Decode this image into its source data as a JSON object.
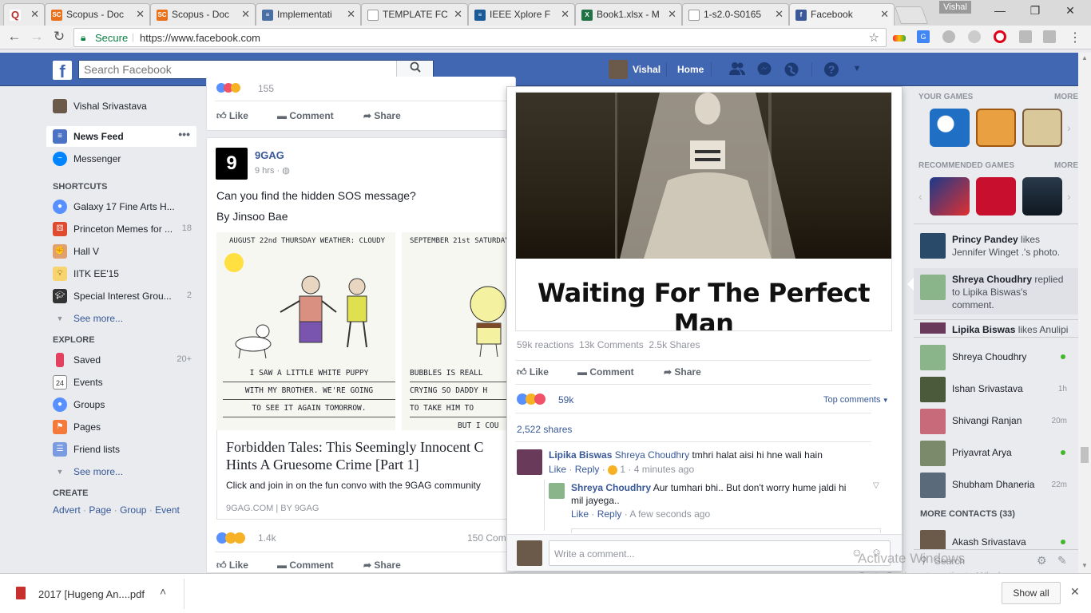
{
  "browser": {
    "tabs": [
      {
        "label": "",
        "icon": "quora-icon",
        "color": "#b92b27",
        "glyph": "Q"
      },
      {
        "label": "Scopus - Doc",
        "icon": "scopus-icon",
        "color": "#e9711c",
        "glyph": "SC"
      },
      {
        "label": "Scopus - Doc",
        "icon": "scopus-icon",
        "color": "#e9711c",
        "glyph": "SC"
      },
      {
        "label": "Implementati",
        "icon": "doc-icon",
        "color": "#4a6fa5",
        "glyph": "≡"
      },
      {
        "label": "TEMPLATE FC",
        "icon": "page-icon",
        "color": "#9e9e9e",
        "glyph": ""
      },
      {
        "label": "IEEE Xplore F",
        "icon": "ieee-icon",
        "color": "#1a5a96",
        "glyph": "≡"
      },
      {
        "label": "Book1.xlsx - M",
        "icon": "excel-icon",
        "color": "#217346",
        "glyph": "X"
      },
      {
        "label": "1-s2.0-S0165",
        "icon": "page-icon",
        "color": "#9e9e9e",
        "glyph": ""
      },
      {
        "label": "Facebook",
        "icon": "facebook-icon",
        "color": "#3b5998",
        "glyph": "f"
      }
    ],
    "profile_label": "Vishal",
    "secure_label": "Secure",
    "url": "https://www.facebook.com"
  },
  "fb": {
    "logo": "f",
    "search_placeholder": "Search Facebook",
    "user_name": "Vishal",
    "home_label": "Home"
  },
  "left_nav": {
    "profile_name": "Vishal Srivastava",
    "news_feed": "News Feed",
    "messenger": "Messenger",
    "shortcuts_head": "SHORTCUTS",
    "shortcuts": [
      {
        "label": "Galaxy 17 Fine Arts H...",
        "count": ""
      },
      {
        "label": "Princeton Memes for ...",
        "count": "18"
      },
      {
        "label": "Hall V",
        "count": ""
      },
      {
        "label": "IITK EE'15",
        "count": ""
      },
      {
        "label": "Special Interest Grou...",
        "count": "2"
      }
    ],
    "see_more": "See more...",
    "explore_head": "EXPLORE",
    "explore": [
      {
        "label": "Saved",
        "count": "20+"
      },
      {
        "label": "Events",
        "count": ""
      },
      {
        "label": "Groups",
        "count": ""
      },
      {
        "label": "Pages",
        "count": ""
      },
      {
        "label": "Friend lists",
        "count": ""
      }
    ],
    "see_more2": "See more...",
    "create_head": "CREATE",
    "create_links": [
      "Advert",
      "Page",
      "Group",
      "Event"
    ]
  },
  "feed": {
    "top_count": "155",
    "like": "Like",
    "comment": "Comment",
    "share": "Share",
    "post": {
      "author": "9GAG",
      "time": "9 hrs",
      "text1": "Can you find the hidden SOS message?",
      "text2": "By Jinsoo Bae",
      "comic_left_header": "AUGUST 22nd THURSDAY   WEATHER: CLOUDY",
      "comic_right_header": "SEPTEMBER 21st SATURDAY",
      "comic_left_caption": [
        "I SAW A LITTLE WHITE PUPPY",
        "WITH MY BROTHER. WE'RE GOING",
        "TO SEE IT AGAIN TOMORROW."
      ],
      "comic_right_caption": [
        "BUBBLES IS REALL",
        "CRYING SO DADDY H",
        "TO TAKE HIM TO",
        "BUT I COU"
      ],
      "link_title": "Forbidden Tales: This Seemingly Innocent C Hints A Gruesome Crime [Part 1]",
      "link_desc": "Click and join in on the fun convo with the 9GAG community",
      "link_domain": "9GAG.COM",
      "link_by": "BY 9GAG",
      "reactions": "1.4k",
      "comments": "150 Com"
    }
  },
  "popup": {
    "image_caption": "Waiting For The Perfect Man",
    "stats": "59k reactions  13k Comments  2.5k Shares",
    "like": "Like",
    "comment": "Comment",
    "share": "Share",
    "reaction_count": "59k",
    "top_comments": "Top comments",
    "shares": "2,522 shares",
    "comment1": {
      "author": "Lipika Biswas",
      "tag": "Shreya Choudhry",
      "text": "tmhri halat aisi hi hne wali hain",
      "like": "Like",
      "reply": "Reply",
      "reacts": "1",
      "time": "4 minutes ago"
    },
    "reply1": {
      "author": "Shreya Choudhry",
      "text": "Aur tumhari bhi.. But don't worry hume jaldi hi mil jayega..",
      "like": "Like",
      "reply": "Reply",
      "time": "A few seconds ago"
    },
    "write_placeholder": "Write a comment..."
  },
  "right": {
    "your_games": "YOUR GAMES",
    "more": "MORE",
    "recommended": "RECOMMENDED GAMES",
    "more2": "MORE",
    "ticker": [
      {
        "name": "Princy Pandey",
        "text": " likes Jennifer Winget .'s photo."
      },
      {
        "name": "Shreya Choudhry",
        "text": " replied to Lipika Biswas's comment."
      },
      {
        "name": "Lipika Biswas",
        "text": " likes Anulipi"
      }
    ],
    "contacts": [
      {
        "name": "Shreya Choudhry",
        "status": "online"
      },
      {
        "name": "Ishan Srivastava",
        "status": "1h"
      },
      {
        "name": "Shivangi Ranjan",
        "status": "20m"
      },
      {
        "name": "Priyavrat Arya",
        "status": "online"
      },
      {
        "name": "Shubham Dhaneria",
        "status": "22m"
      }
    ],
    "more_contacts": "MORE CONTACTS (33)",
    "more_contact_name": "Akash Srivastava",
    "chat_search": "Search",
    "watermark1": "Activate Windows",
    "watermark2": "Go to Settings to activate Windows."
  },
  "downloads": {
    "file": "2017 [Hugeng An....pdf",
    "show_all": "Show all"
  }
}
